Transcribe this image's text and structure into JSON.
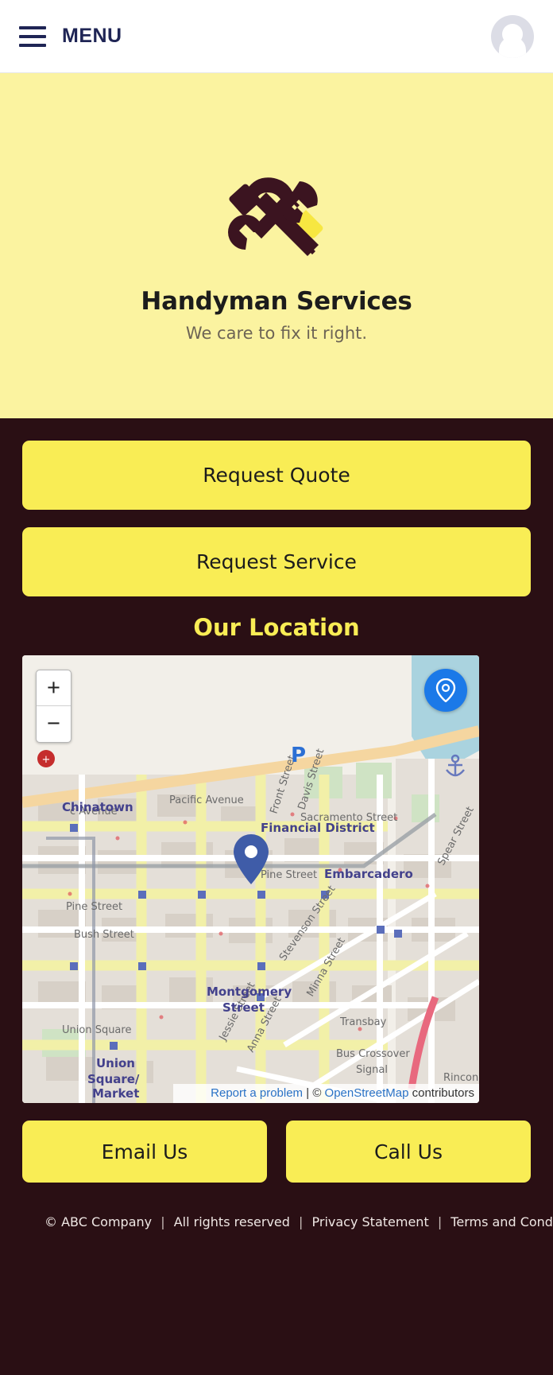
{
  "header": {
    "menu_label": "MENU",
    "menu_icon": "hamburger-icon",
    "avatar_icon": "user-avatar-placeholder"
  },
  "hero": {
    "logo_icon": "hammer-and-wrench-icon",
    "title": "Handyman Services",
    "subtitle": "We care to fix it right.",
    "bg_color": "#fbf3a0",
    "logo_color": "#3b1420",
    "logo_accent_color": "#f7e741"
  },
  "actions": {
    "request_quote": "Request Quote",
    "request_service": "Request Service",
    "button_color": "#f9ed55",
    "button_text_color": "#1c1c1c"
  },
  "location": {
    "section_title": "Our Location",
    "title_color": "#f9ed55",
    "map": {
      "zoom_in_label": "+",
      "zoom_out_label": "−",
      "locate_icon": "map-pin-locate-icon",
      "marker_icon": "map-marker-pin",
      "parking_icon": "P",
      "poi_icon": "red-poi-marker",
      "attribution": {
        "report_link": "Report a problem",
        "separator": "|",
        "copyright": "©",
        "osm_link": "OpenStreetMap",
        "contributors": "contributors"
      },
      "labels": [
        "Pacific Avenue",
        "Davis Street",
        "Front Street",
        "Chinatown",
        "Sacramento Street",
        "Financial District",
        "Pine Street",
        "Embarcadero",
        "Spear Street",
        "Pine Street",
        "Bush Street",
        "Stevenson Street",
        "Montgomery Street",
        "Minna Street",
        "Transbay",
        "Union Square",
        "Jessie Street",
        "Anna Street",
        "Bus Crossover Signal",
        "Union Square/ Market",
        "Rincon"
      ]
    }
  },
  "contact": {
    "email_label": "Email Us",
    "call_label": "Call Us"
  },
  "footer": {
    "copyright": "© ABC Company",
    "rights": "All rights reserved",
    "privacy": "Privacy Statement",
    "terms": "Terms and Conditions",
    "sep": "|"
  }
}
